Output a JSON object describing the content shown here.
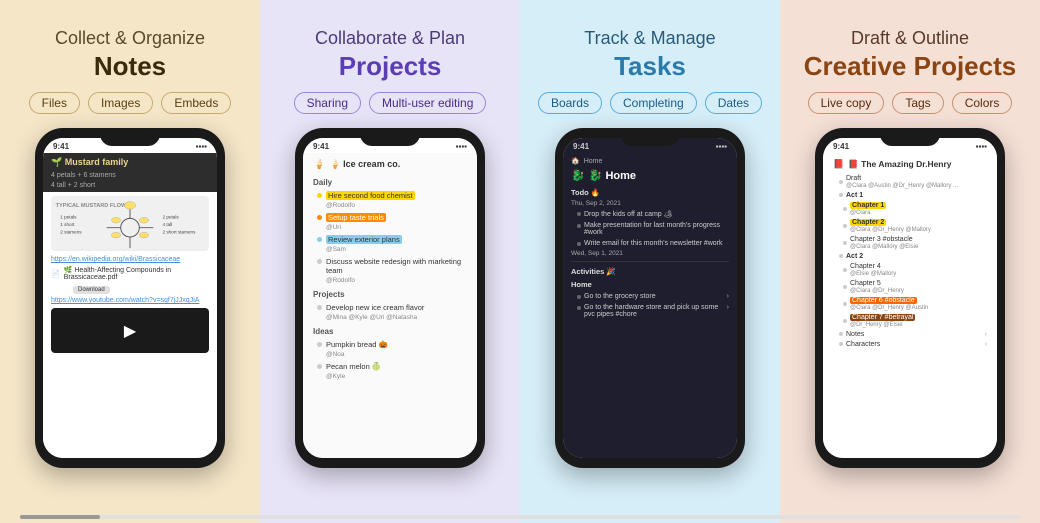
{
  "panel1": {
    "title_small": "Collect & Organize",
    "title_large": "Notes",
    "tags": [
      "Files",
      "Images",
      "Embeds"
    ],
    "phone": {
      "header_title": "🌱 Mustard family",
      "meta1": "4 petals + 6 stamens",
      "meta2": "4 tall + 2 short",
      "image_alt": "Typical mustard flower diagram",
      "link": "https://en.wikipedia.org/wiki/Brassicaceae",
      "file_name": "🌿 Health-Affecting Compounds in Brassicaceae.pdf",
      "download_label": "Download",
      "video_link": "https://www.youtube.com/watch?v=sgf7jJJxqJiA"
    }
  },
  "panel2": {
    "title_small": "Collaborate & Plan",
    "title_large": "Projects",
    "tags": [
      "Sharing",
      "Multi-user editing"
    ],
    "phone": {
      "header_title": "🍦 Ice cream co.",
      "sections": [
        {
          "label": "Daily",
          "items": [
            {
              "text": "Hire second food chemist",
              "user": "@Rodolfo",
              "highlight": "yellow"
            },
            {
              "text": "Setup taste trials",
              "user": "@Uri",
              "highlight": "orange"
            },
            {
              "text": "Review exterior plans",
              "user": "@Sam",
              "highlight": "blue"
            },
            {
              "text": "Discuss website redesign with marketing team",
              "user": "@Rodolfo",
              "highlight": "none"
            }
          ]
        },
        {
          "label": "Projects",
          "items": [
            {
              "text": "Develop new ice cream flavor",
              "user": "@Mina @Kyle @Uri @Natasha",
              "highlight": "none"
            }
          ]
        },
        {
          "label": "Ideas",
          "items": [
            {
              "text": "Pumpkin bread 🎃",
              "user": "@Noa",
              "highlight": "none"
            },
            {
              "text": "Pecan melon 🍈",
              "user": "@Kyle",
              "highlight": "none"
            }
          ]
        }
      ]
    }
  },
  "panel3": {
    "title_small": "Track & Manage",
    "title_large": "Tasks",
    "tags": [
      "Boards",
      "Completing",
      "Dates"
    ],
    "phone": {
      "nav": "Home",
      "header_title": "🐉 Home",
      "sections": [
        {
          "label": "Todo 🔥",
          "date": "Thu, Sep 2, 2021",
          "items": [
            "Drop the kids off at camp 🏕",
            "Make presentation for last month's progress #work",
            "Write email for this month's newsletter #work"
          ]
        },
        {
          "date": "Wed, Sep 1, 2021",
          "items": []
        },
        {
          "label": "Activities 🎉",
          "items": []
        },
        {
          "label": "Home",
          "items": [
            "Go to the grocery store",
            "Go to the hardware store and pick up some pvc pipes #chore"
          ]
        }
      ]
    }
  },
  "panel4": {
    "title_small": "Draft & Outline",
    "title_large": "Creative Projects",
    "tags": [
      "Live copy",
      "Tags",
      "Colors"
    ],
    "phone": {
      "header_title": "📕 The Amazing Dr.Henry",
      "sections": [
        {
          "label": "Draft",
          "user": "@Clara @Austin @Dr_Henry @Mallory ...",
          "items": []
        },
        {
          "label": "Act 1",
          "items": [
            {
              "text": "Chapter 1",
              "user": "@Clara",
              "highlight": "yellow"
            },
            {
              "text": "Chapter 2",
              "user": "@Clara @Dr_Henry @Mallory",
              "highlight": "yellow"
            },
            {
              "text": "Chapter 3 #obstacle",
              "user": "@Clara @Mallory @Elsie",
              "highlight": "none"
            }
          ]
        },
        {
          "label": "Act 2",
          "items": [
            {
              "text": "Chapter 4",
              "user": "@Elsie @Mallory",
              "highlight": "none"
            },
            {
              "text": "Chapter 5",
              "user": "@Clara @Dr_Henry",
              "highlight": "none"
            },
            {
              "text": "Chapter 6 #obstacle",
              "user": "@Clara @Dr_Henry @Austin",
              "highlight": "orange"
            },
            {
              "text": "Chapter 7 #betrayal",
              "user": "@Dr_Henry @Elsie",
              "highlight": "brown"
            }
          ]
        },
        {
          "label": "Notes",
          "items": []
        },
        {
          "label": "Characters",
          "items": []
        }
      ]
    }
  },
  "scrollbar": {
    "label": "page scrollbar"
  }
}
